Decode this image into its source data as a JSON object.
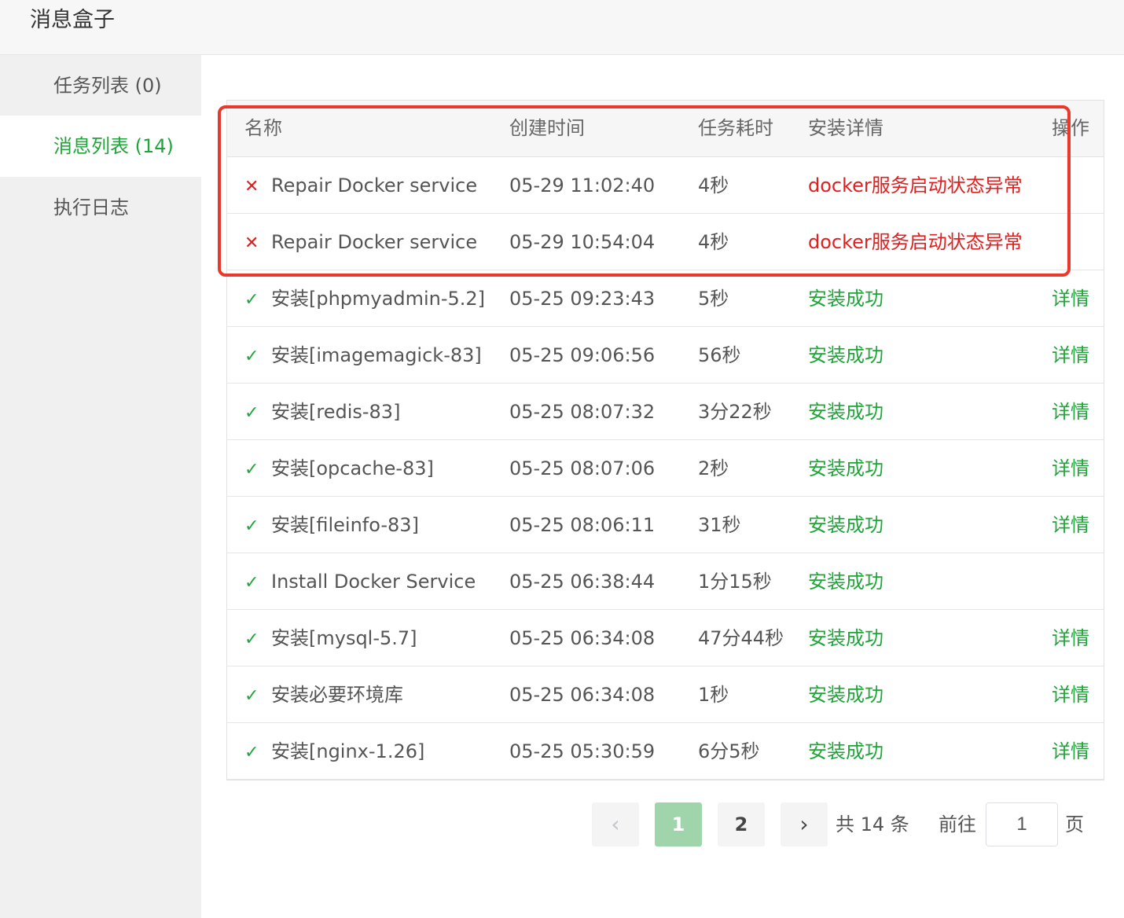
{
  "window": {
    "title": "消息盒子"
  },
  "sidebar": {
    "items": [
      {
        "label": "任务列表 (0)",
        "active": false
      },
      {
        "label": "消息列表 (14)",
        "active": true
      },
      {
        "label": "执行日志",
        "active": false
      }
    ]
  },
  "table": {
    "headers": {
      "name": "名称",
      "time": "创建时间",
      "duration": "任务耗时",
      "detail": "安装详情",
      "action": "操作"
    },
    "rows": [
      {
        "status": "error",
        "icon": "✕",
        "name": "Repair Docker service",
        "time": "05-29 11:02:40",
        "duration": "4秒",
        "detail": "docker服务启动状态异常",
        "action": ""
      },
      {
        "status": "error",
        "icon": "✕",
        "name": "Repair Docker service",
        "time": "05-29 10:54:04",
        "duration": "4秒",
        "detail": "docker服务启动状态异常",
        "action": ""
      },
      {
        "status": "success",
        "icon": "✓",
        "name": "安装[phpmyadmin-5.2]",
        "time": "05-25 09:23:43",
        "duration": "5秒",
        "detail": "安装成功",
        "action": "详情"
      },
      {
        "status": "success",
        "icon": "✓",
        "name": "安装[imagemagick-83]",
        "time": "05-25 09:06:56",
        "duration": "56秒",
        "detail": "安装成功",
        "action": "详情"
      },
      {
        "status": "success",
        "icon": "✓",
        "name": "安装[redis-83]",
        "time": "05-25 08:07:32",
        "duration": "3分22秒",
        "detail": "安装成功",
        "action": "详情"
      },
      {
        "status": "success",
        "icon": "✓",
        "name": "安装[opcache-83]",
        "time": "05-25 08:07:06",
        "duration": "2秒",
        "detail": "安装成功",
        "action": "详情"
      },
      {
        "status": "success",
        "icon": "✓",
        "name": "安装[fileinfo-83]",
        "time": "05-25 08:06:11",
        "duration": "31秒",
        "detail": "安装成功",
        "action": "详情"
      },
      {
        "status": "success",
        "icon": "✓",
        "name": "Install Docker Service",
        "time": "05-25 06:38:44",
        "duration": "1分15秒",
        "detail": "安装成功",
        "action": ""
      },
      {
        "status": "success",
        "icon": "✓",
        "name": "安装[mysql-5.7]",
        "time": "05-25 06:34:08",
        "duration": "47分44秒",
        "detail": "安装成功",
        "action": "详情"
      },
      {
        "status": "success",
        "icon": "✓",
        "name": "安装必要环境库",
        "time": "05-25 06:34:08",
        "duration": "1秒",
        "detail": "安装成功",
        "action": "详情"
      },
      {
        "status": "success",
        "icon": "✓",
        "name": "安装[nginx-1.26]",
        "time": "05-25 05:30:59",
        "duration": "6分5秒",
        "detail": "安装成功",
        "action": "详情"
      }
    ]
  },
  "pagination": {
    "prev_icon": "‹",
    "next_icon": "›",
    "pages": [
      "1",
      "2"
    ],
    "current_page": "1",
    "total_text": "共 14 条",
    "goto_label": "前往",
    "goto_value": "1",
    "page_suffix": "页"
  },
  "colors": {
    "accent": "#20a53a",
    "error": "#e02020",
    "highlight": "#e8392c"
  }
}
